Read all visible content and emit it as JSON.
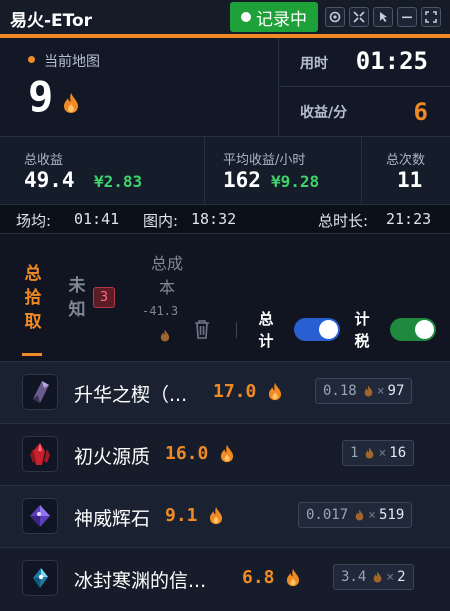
{
  "app": {
    "title": "易火-ETor",
    "record_label": "记录中"
  },
  "colors": {
    "accent": "#f08a24",
    "green": "#1fa13a",
    "money": "#3ed36a",
    "blue_switch": "#2a5fd1"
  },
  "stats": {
    "map_label": "当前地图",
    "map_value": "9",
    "time_label": "用时",
    "time_value": "01:25",
    "rate_label": "收益/分",
    "rate_value": "6"
  },
  "totals": {
    "total_label": "总收益",
    "total_value": "49.4",
    "total_money": "¥2.83",
    "avg_label": "平均收益/小时",
    "avg_value": "162",
    "avg_money": "¥9.28",
    "count_label": "总次数",
    "count_value": "11"
  },
  "timebar": {
    "avg_label": "场均:",
    "avg_value": "01:41",
    "inner_label": "图内:",
    "inner_value": "18:32",
    "total_label": "总时长:",
    "total_value": "21:23"
  },
  "tabs": {
    "pickup": "总拾取",
    "unknown": "未知",
    "unknown_count": "3",
    "cost_label": "总成本",
    "cost_value": "-41.3",
    "total_switch_label": "总计",
    "tax_switch_label": "计税"
  },
  "items": [
    {
      "name": "升华之楔（...",
      "value": "17.0",
      "price": "0.18",
      "qty": "97",
      "icon": "purple-shard-icon"
    },
    {
      "name": "初火源质",
      "value": "16.0",
      "price": "1",
      "qty": "16",
      "icon": "red-crystal-icon"
    },
    {
      "name": "神威辉石",
      "value": "9.1",
      "price": "0.017",
      "qty": "519",
      "icon": "violet-gem-icon"
    },
    {
      "name": "冰封寒渊的信...",
      "value": "6.8",
      "price": "3.4",
      "qty": "2",
      "icon": "ice-crystal-icon"
    }
  ]
}
